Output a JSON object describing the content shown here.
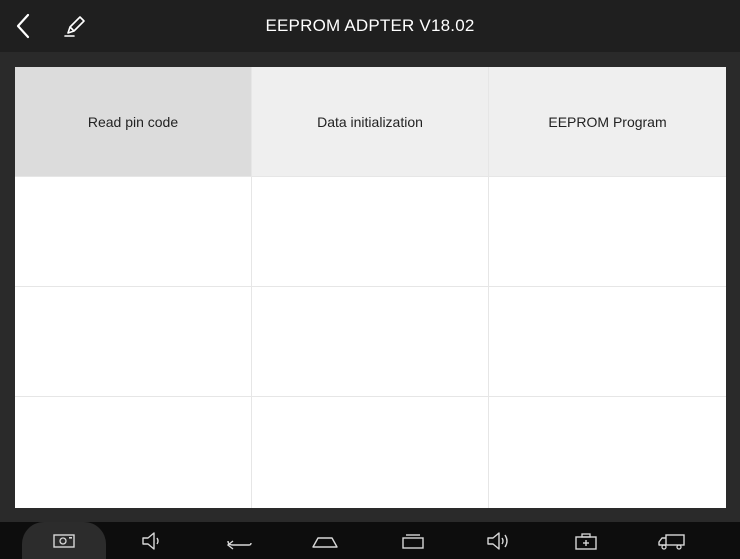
{
  "header": {
    "title": "EEPROM ADPTER V18.02",
    "back_icon": "back-arrow-icon",
    "edit_icon": "pen-icon"
  },
  "functions": [
    {
      "label": "Read pin code",
      "selected": true
    },
    {
      "label": "Data initialization",
      "selected": false
    },
    {
      "label": "EEPROM Program",
      "selected": false
    }
  ],
  "navbar": {
    "icons": [
      "screenshot-icon",
      "volume-down-icon",
      "back-icon",
      "home-icon",
      "recent-apps-icon",
      "volume-up-icon",
      "diagnostic-kit-icon",
      "truck-icon"
    ]
  },
  "colors": {
    "topbar": "#1f1f1f",
    "selected_cell": "#dcdcdc",
    "function_cell": "#efefef",
    "navbar": "#0d0d0d"
  }
}
